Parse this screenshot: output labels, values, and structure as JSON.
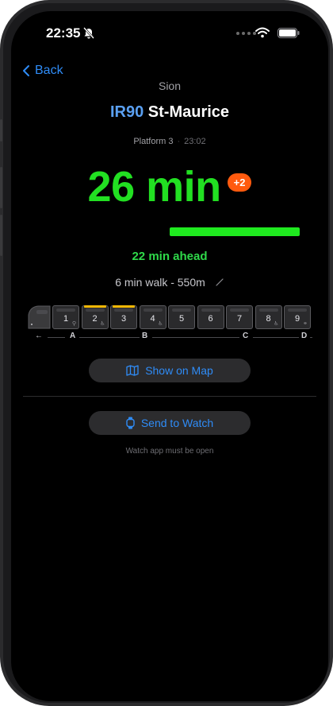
{
  "status_bar": {
    "time": "22:35"
  },
  "nav": {
    "back_label": "Back"
  },
  "header": {
    "station": "Sion",
    "line": "IR90",
    "destination": "St-Maurice",
    "platform": "Platform 3",
    "departure_time": "23:02"
  },
  "countdown": {
    "value": "26 min",
    "delay_badge": "+2",
    "ahead_text": "22 min ahead",
    "progress_fraction": 1.0
  },
  "walk": {
    "text": "6 min walk - 550m"
  },
  "train": {
    "cars": [
      {
        "number": "1",
        "highlight": false,
        "icon": "stroller"
      },
      {
        "number": "2",
        "highlight": true,
        "icon": "wheelchair"
      },
      {
        "number": "3",
        "highlight": true,
        "icon": ""
      },
      {
        "number": "4",
        "highlight": false,
        "icon": "wheelchair"
      },
      {
        "number": "5",
        "highlight": false,
        "icon": ""
      },
      {
        "number": "6",
        "highlight": false,
        "icon": ""
      },
      {
        "number": "7",
        "highlight": false,
        "icon": ""
      },
      {
        "number": "8",
        "highlight": false,
        "icon": "wheelchair"
      },
      {
        "number": "9",
        "highlight": false,
        "icon": "family"
      }
    ],
    "sectors": [
      "A",
      "B",
      "C",
      "D"
    ],
    "highlight_color": "#f2b705"
  },
  "actions": {
    "show_on_map": "Show on Map",
    "send_to_watch": "Send to Watch",
    "watch_note": "Watch app must be open"
  },
  "colors": {
    "accent": "#2f8cf7",
    "countdown": "#22e022",
    "delay": "#ff5a0e"
  }
}
